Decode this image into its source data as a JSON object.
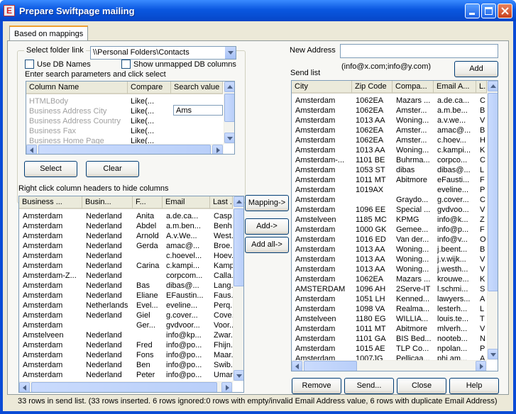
{
  "window": {
    "title": "Prepare Swiftpage mailing",
    "icon_letter": "E"
  },
  "tab": {
    "label": "Based on mappings"
  },
  "folder": {
    "label": "Select folder link",
    "value": "\\\\Personal Folders\\Contacts"
  },
  "options": {
    "use_db_names": "Use DB Names",
    "show_unmapped": "Show unmapped DB columns"
  },
  "search": {
    "instruction": "Enter search parameters and click select",
    "headers": [
      "Column Name",
      "Compare",
      "Search value"
    ],
    "rows": [
      {
        "column": "HTMLBody",
        "compare": "Like(...",
        "value": ""
      },
      {
        "column": "Business Address City",
        "compare": "Like(...",
        "value": "Ams"
      },
      {
        "column": "Business Address Country",
        "compare": "Like(...",
        "value": ""
      },
      {
        "column": "Business Fax",
        "compare": "Like(...",
        "value": ""
      },
      {
        "column": "Business Home Page",
        "compare": "Like(...",
        "value": ""
      }
    ]
  },
  "buttons": {
    "select": "Select",
    "clear": "Clear",
    "mapping": "Mapping->",
    "add": "Add->",
    "add_all": "Add all->",
    "new_add": "Add",
    "remove": "Remove",
    "send": "Send...",
    "close": "Close",
    "help": "Help"
  },
  "left_list": {
    "hint": "Right click column headers to hide columns",
    "headers": [
      "Business ...",
      "Busin...",
      "F...",
      "Email",
      "Last ..."
    ],
    "rows": [
      [
        "Amsterdam",
        "Nederland",
        "Anita",
        "a.de.ca...",
        "Casp..."
      ],
      [
        "Amsterdam",
        "Nederland",
        "Abdel",
        "a.m.ben...",
        "Benh..."
      ],
      [
        "Amsterdam",
        "Nederland",
        "Arnold",
        "A.v.We...",
        "West..."
      ],
      [
        "Amsterdam",
        "Nederland",
        "Gerda",
        "amac@...",
        "Broe..."
      ],
      [
        "Amsterdam",
        "Nederland",
        "",
        "c.hoevel...",
        "Hoev..."
      ],
      [
        "Amsterdam",
        "Nederland",
        "Carina",
        "c.kampi...",
        "Kamp..."
      ],
      [
        "Amsterdam-Z...",
        "Nederland",
        "",
        "corpcom...",
        "Calla..."
      ],
      [
        "Amsterdam",
        "Nederland",
        "Bas",
        "dibas@...",
        "Lang..."
      ],
      [
        "Amsterdam",
        "Nederland",
        "Eliane",
        "EFaustin...",
        "Faus..."
      ],
      [
        "Amsterdam",
        "Netherlands",
        "Evel...",
        "eveline...",
        "Perq..."
      ],
      [
        "Amsterdam",
        "Nederland",
        "Giel",
        "g.cover...",
        "Cove..."
      ],
      [
        "Amsterdam",
        "",
        "Ger...",
        "gvdvoor...",
        "Voor..."
      ],
      [
        "Amstelveen",
        "Nederland",
        "",
        "info@kp...",
        "Zwar..."
      ],
      [
        "Amsterdam",
        "Nederland",
        "Fred",
        "info@po...",
        "Fhijn..."
      ],
      [
        "Amsterdam",
        "Nederland",
        "Fons",
        "info@po...",
        "Maar..."
      ],
      [
        "Amsterdam",
        "Nederland",
        "Ben",
        "info@po...",
        "Swib..."
      ],
      [
        "Amsterdam",
        "Nederland",
        "Peter",
        "info@po...",
        "Umar..."
      ]
    ]
  },
  "new_address": {
    "label": "New Address",
    "value": "",
    "hint": "(info@x.com;info@y.com)"
  },
  "send_list": {
    "label": "Send list",
    "headers": [
      "City",
      "Zip Code",
      "Compa...",
      "Email A...",
      "L..."
    ],
    "rows": [
      [
        "Amsterdam",
        "1062EA",
        "Mazars ...",
        "a.de.ca...",
        "C"
      ],
      [
        "Amsterdam",
        "1062EA",
        "Amster...",
        "a.m.be...",
        "B"
      ],
      [
        "Amsterdam",
        "1013 AA",
        "Woning...",
        "a.v.we...",
        "V"
      ],
      [
        "Amsterdam",
        "1062EA",
        "Amster...",
        "amac@...",
        "B"
      ],
      [
        "Amsterdam",
        "1062EA",
        "Amster...",
        "c.hoev...",
        "H"
      ],
      [
        "Amsterdam",
        "1013 AA",
        "Woning...",
        "c.kampi...",
        "K"
      ],
      [
        "Amsterdam-...",
        "1101 BE",
        "Buhrma...",
        "corpco...",
        "C"
      ],
      [
        "Amsterdam",
        "1053 ST",
        "dibas",
        "dibas@...",
        "L"
      ],
      [
        "Amsterdam",
        "1011 MT",
        "Abitmore",
        "eFausti...",
        "F"
      ],
      [
        "Amsterdam",
        "1019AX",
        "",
        "eveline...",
        "P"
      ],
      [
        "Amsterdam",
        "",
        "Graydo...",
        "g.cover...",
        "C"
      ],
      [
        "Amsterdam",
        "1096 EE",
        "Special ...",
        "gvdvoo...",
        "V"
      ],
      [
        "Amstelveen",
        "1185 MC",
        "KPMG",
        "info@k...",
        "Z"
      ],
      [
        "Amsterdam",
        "1000 GK",
        "Gemee...",
        "info@p...",
        "F"
      ],
      [
        "Amsterdam",
        "1016 ED",
        "Van der...",
        "info@v...",
        "O"
      ],
      [
        "Amsterdam",
        "1013 AA",
        "Woning...",
        "j.beent...",
        "B"
      ],
      [
        "Amsterdam",
        "1013 AA",
        "Woning...",
        "j.v.wijk...",
        "V"
      ],
      [
        "Amsterdam",
        "1013 AA",
        "Woning...",
        "j.westh...",
        "V"
      ],
      [
        "Amsterdam",
        "1062EA",
        "Mazars ...",
        "krouwe...",
        "K"
      ],
      [
        "AMSTERDAM",
        "1096 AH",
        "2Serve-IT",
        "l.schmi...",
        "S"
      ],
      [
        "Amsterdam",
        "1051 LH",
        "Kenned...",
        "lawyers...",
        "A"
      ],
      [
        "Amsterdam",
        "1098 VA",
        "Realma...",
        "lesterh...",
        "L"
      ],
      [
        "Amstelveen",
        "1180 EG",
        "WILLIA...",
        "louis.te...",
        "T"
      ],
      [
        "Amsterdam",
        "1011 MT",
        "Abitmore",
        "mlverh...",
        "V"
      ],
      [
        "Amsterdam",
        "1101 GA",
        "BIS Bed...",
        "nooteb...",
        "N"
      ],
      [
        "Amsterdam",
        "1015 AE",
        "TLP Co...",
        "npolan...",
        "P"
      ],
      [
        "Amsterdam",
        "1007JG",
        "Pellicaa...",
        "phi.am...",
        "A"
      ]
    ]
  },
  "status": "33 rows in send list. (33 rows inserted. 6 rows ignored:0 rows with empty/invalid Email Address value, 6 rows with duplicate Email Address)"
}
